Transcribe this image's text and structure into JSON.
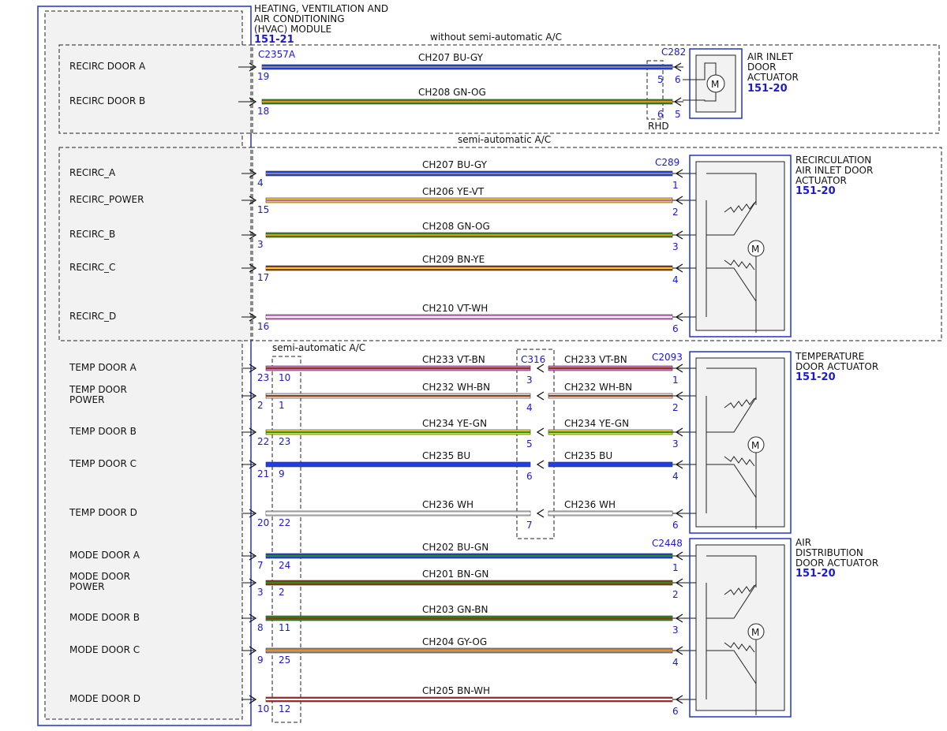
{
  "module": {
    "title_lines": [
      "HEATING, VENTILATION AND",
      "AIR CONDITIONING",
      "(HVAC) MODULE"
    ],
    "ref": "151-21",
    "connector": "C2357A"
  },
  "sections": {
    "without_semi": "without semi-automatic A/C",
    "semi_top": "semi-automatic A/C",
    "semi_temp": "semi-automatic A/C",
    "rhd": "RHD"
  },
  "actuators": [
    {
      "id": "air-inlet",
      "lines": [
        "AIR INLET",
        "DOOR",
        "ACTUATOR"
      ],
      "ref": "151-20",
      "connector": "C282"
    },
    {
      "id": "recirc",
      "lines": [
        "RECIRCULATION",
        "AIR INLET DOOR",
        "ACTUATOR"
      ],
      "ref": "151-20",
      "connector": "C289"
    },
    {
      "id": "temp",
      "lines": [
        "TEMPERATURE",
        "DOOR ACTUATOR"
      ],
      "ref": "151-20",
      "connector": "C2093"
    },
    {
      "id": "air-dist",
      "lines": [
        "AIR",
        "DISTRIBUTION",
        "DOOR ACTUATOR"
      ],
      "ref": "151-20",
      "connector": "C2448"
    }
  ],
  "inline_connector": "C316",
  "signals_a": [
    {
      "label": "RECIRC DOOR A",
      "pin": "19",
      "circuit": "CH207",
      "color": "BU-GY",
      "c1": "#1f3fe0",
      "c2": "#8a8a8a",
      "rhd_pin": "5",
      "end_pin": "6"
    },
    {
      "label": "RECIRC DOOR B",
      "pin": "18",
      "circuit": "CH208",
      "color": "GN-OG",
      "c1": "#2d8a1e",
      "c2": "#f08c1a",
      "rhd_pin": "6",
      "end_pin": "5"
    }
  ],
  "signals_b": [
    {
      "label": "RECIRC_A",
      "pin": "4",
      "circuit": "CH207",
      "color": "BU-GY",
      "c1": "#1f3fe0",
      "c2": "#8a8a8a",
      "end_pin": "1"
    },
    {
      "label": "RECIRC_POWER",
      "pin": "15",
      "circuit": "CH206",
      "color": "YE-VT",
      "c1": "#f0d020",
      "c2": "#c060c0",
      "end_pin": "2"
    },
    {
      "label": "RECIRC_B",
      "pin": "3",
      "circuit": "CH208",
      "color": "GN-OG",
      "c1": "#2d8a1e",
      "c2": "#f08c1a",
      "end_pin": "3"
    },
    {
      "label": "RECIRC_C",
      "pin": "17",
      "circuit": "CH209",
      "color": "BN-YE",
      "c1": "#8a3a10",
      "c2": "#f0d020",
      "end_pin": "4"
    },
    {
      "label": "RECIRC_D",
      "pin": "16",
      "circuit": "CH210",
      "color": "VT-WH",
      "c1": "#d070d0",
      "c2": "#ffffff",
      "end_pin": "6"
    }
  ],
  "signals_temp": [
    {
      "label": "TEMP DOOR A",
      "label2": "",
      "pin": "23",
      "semi_pin": "10",
      "circuit": "CH233",
      "color": "VT-BN",
      "c1": "#d070d0",
      "c2": "#8a3a10",
      "mid_pin": "3",
      "end_pin": "1"
    },
    {
      "label": "TEMP DOOR",
      "label2": "POWER",
      "pin": "2",
      "semi_pin": "1",
      "circuit": "CH232",
      "color": "WH-BN",
      "c1": "#dddddd",
      "c2": "#8a3a10",
      "mid_pin": "4",
      "end_pin": "2"
    },
    {
      "label": "TEMP DOOR B",
      "label2": "",
      "pin": "22",
      "semi_pin": "23",
      "circuit": "CH234",
      "color": "YE-GN",
      "c1": "#e8e020",
      "c2": "#2d8a1e",
      "mid_pin": "5",
      "end_pin": "3"
    },
    {
      "label": "TEMP DOOR C",
      "label2": "",
      "pin": "21",
      "semi_pin": "9",
      "circuit": "CH235",
      "color": "BU",
      "c1": "#1f3fe0",
      "c2": "#1f3fe0",
      "mid_pin": "6",
      "end_pin": "4"
    },
    {
      "label": "TEMP DOOR D",
      "label2": "",
      "pin": "20",
      "semi_pin": "22",
      "circuit": "CH236",
      "color": "WH",
      "c1": "#cccccc",
      "c2": "#ffffff",
      "mid_pin": "7",
      "end_pin": "6"
    }
  ],
  "signals_mode": [
    {
      "label": "MODE DOOR A",
      "label2": "",
      "pin": "7",
      "semi_pin": "24",
      "circuit": "CH202",
      "color": "BU-GN",
      "c1": "#1f3fe0",
      "c2": "#2d8a1e",
      "end_pin": "1"
    },
    {
      "label": "MODE DOOR",
      "label2": "POWER",
      "pin": "3",
      "semi_pin": "2",
      "circuit": "CH201",
      "color": "BN-GN",
      "c1": "#8a3a10",
      "c2": "#2d8a1e",
      "end_pin": "2"
    },
    {
      "label": "MODE DOOR B",
      "label2": "",
      "pin": "8",
      "semi_pin": "11",
      "circuit": "CH203",
      "color": "GN-BN",
      "c1": "#2d8a1e",
      "c2": "#8a3a10",
      "end_pin": "3"
    },
    {
      "label": "MODE DOOR C",
      "label2": "",
      "pin": "9",
      "semi_pin": "25",
      "circuit": "CH204",
      "color": "GY-OG",
      "c1": "#8a8a8a",
      "c2": "#f08c1a",
      "end_pin": "4"
    },
    {
      "label": "MODE DOOR D",
      "label2": "",
      "pin": "10",
      "semi_pin": "12",
      "circuit": "CH205",
      "color": "BN-WH",
      "c1": "#b03030",
      "c2": "#ffffff",
      "end_pin": "6"
    }
  ],
  "colors": {
    "accent_blue": "#1a1ad0",
    "box_blue": "#2233cc"
  },
  "motor_symbol": "M"
}
